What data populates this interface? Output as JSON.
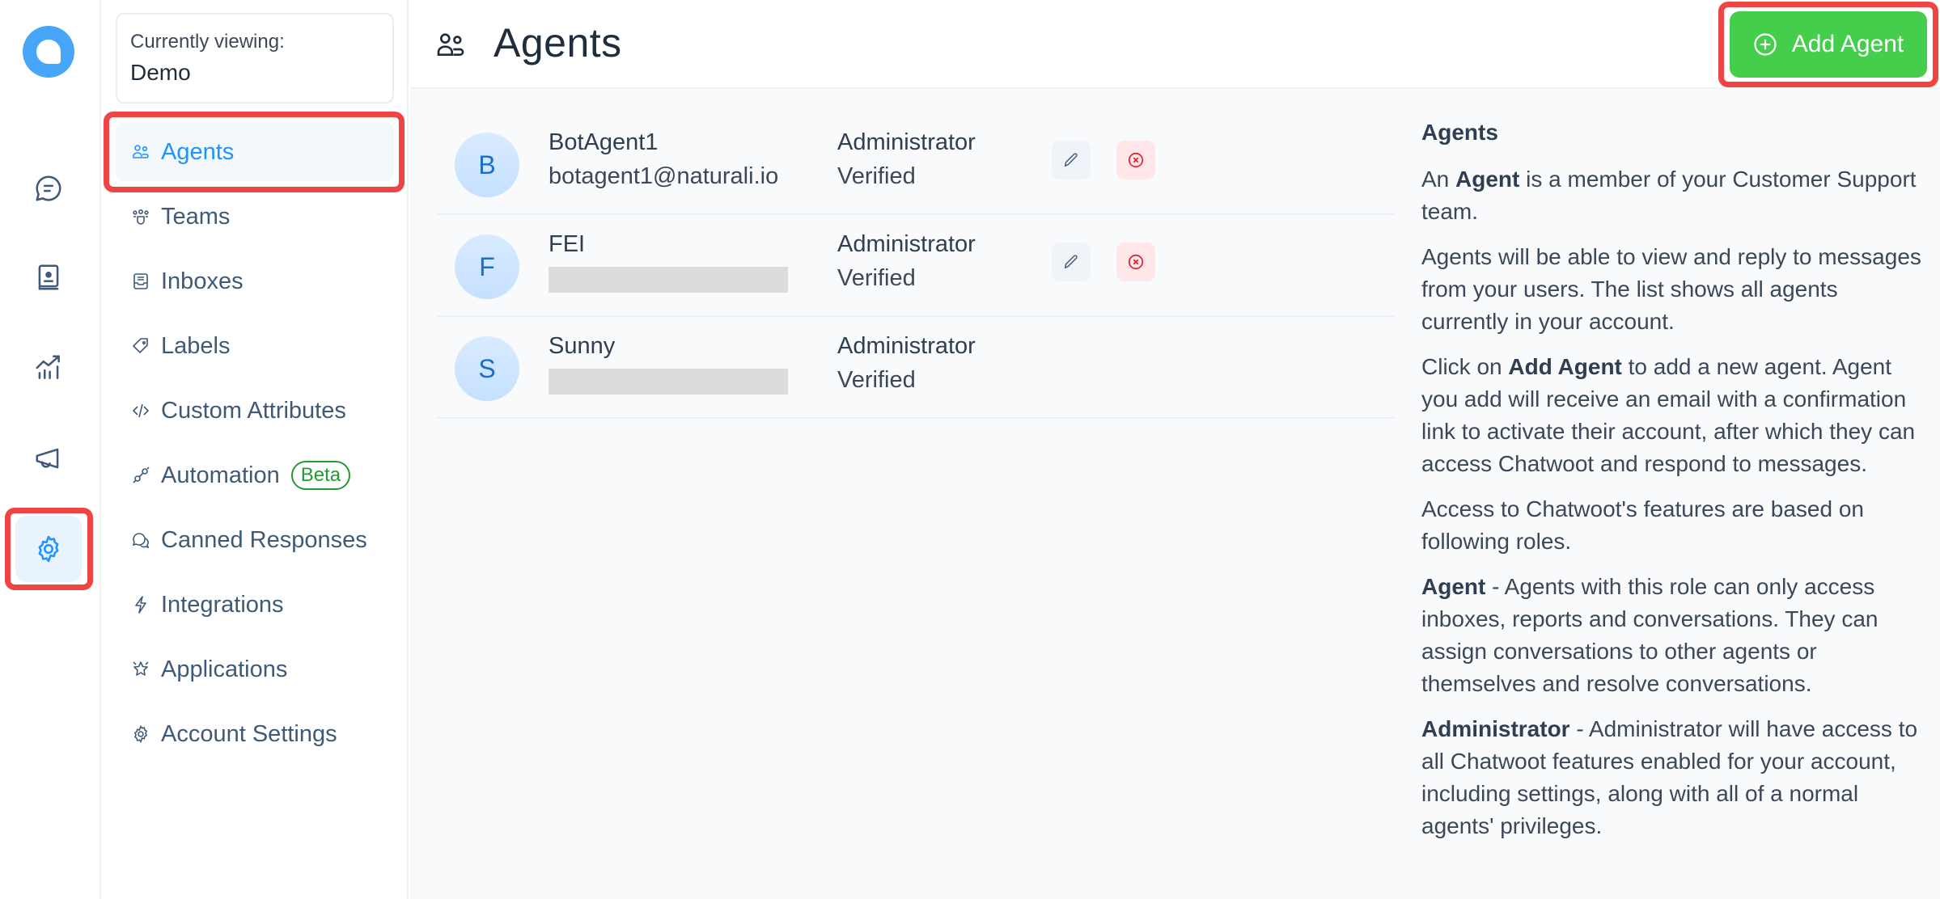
{
  "rail": {
    "items": [
      {
        "name": "conversations",
        "icon": "chat-bubble-icon"
      },
      {
        "name": "contacts",
        "icon": "contact-book-icon"
      },
      {
        "name": "reports",
        "icon": "chart-trend-icon"
      },
      {
        "name": "campaigns",
        "icon": "megaphone-icon"
      },
      {
        "name": "settings",
        "icon": "gear-icon",
        "active": true
      }
    ]
  },
  "account": {
    "label": "Currently viewing:",
    "name": "Demo"
  },
  "sidebar": {
    "items": [
      {
        "label": "Agents",
        "icon": "agents-icon",
        "active": true
      },
      {
        "label": "Teams",
        "icon": "teams-icon"
      },
      {
        "label": "Inboxes",
        "icon": "inbox-icon"
      },
      {
        "label": "Labels",
        "icon": "tag-icon"
      },
      {
        "label": "Custom Attributes",
        "icon": "code-icon"
      },
      {
        "label": "Automation",
        "icon": "automation-icon",
        "badge": "Beta"
      },
      {
        "label": "Canned Responses",
        "icon": "chat-multiple-icon"
      },
      {
        "label": "Integrations",
        "icon": "lightning-icon"
      },
      {
        "label": "Applications",
        "icon": "star-burst-icon"
      },
      {
        "label": "Account Settings",
        "icon": "gear-icon"
      }
    ]
  },
  "header": {
    "title": "Agents",
    "add_button": "Add Agent"
  },
  "agents": [
    {
      "initial": "B",
      "name": "BotAgent1",
      "email": "botagent1@naturali.io",
      "email_redacted": false,
      "role": "Administrator",
      "status": "Verified",
      "actions": true
    },
    {
      "initial": "F",
      "name": "FEI",
      "email": "",
      "email_redacted": true,
      "role": "Administrator",
      "status": "Verified",
      "actions": true
    },
    {
      "initial": "S",
      "name": "Sunny",
      "email": "",
      "email_redacted": true,
      "role": "Administrator",
      "status": "Verified",
      "actions": false
    }
  ],
  "help": {
    "title": "Agents",
    "p1_pre": "An ",
    "p1_bold": "Agent",
    "p1_post": " is a member of your Customer Support team.",
    "p2": "Agents will be able to view and reply to messages from your users. The list shows all agents currently in your account.",
    "p3_pre": "Click on ",
    "p3_bold": "Add Agent",
    "p3_post": " to add a new agent. Agent you add will receive an email with a confirmation link to activate their account, after which they can access Chatwoot and respond to messages.",
    "p4": "Access to Chatwoot's features are based on following roles.",
    "p5_bold": "Agent",
    "p5_post": " - Agents with this role can only access inboxes, reports and conversations. They can assign conversations to other agents or themselves and resolve conversations.",
    "p6_bold": "Administrator",
    "p6_post": " - Administrator will have access to all Chatwoot features enabled for your account, including settings, along with all of a normal agents' privileges."
  },
  "colors": {
    "accent": "#1f93ff",
    "add_button": "#44ce4b",
    "highlight": "#ef4444",
    "delete": "#e11d2a",
    "beta": "#1f9d2f"
  }
}
